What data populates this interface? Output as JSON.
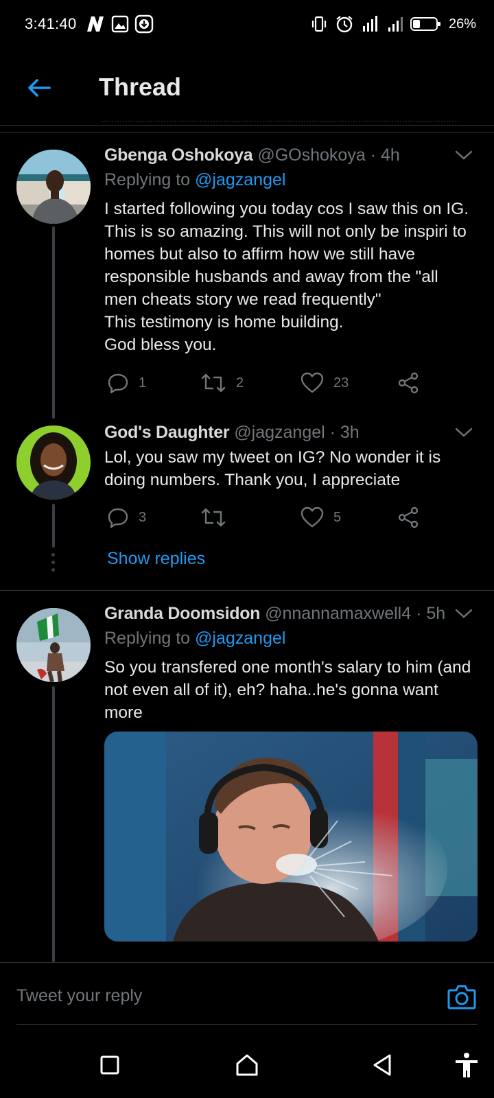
{
  "status_bar": {
    "time": "3:41:40",
    "battery": "26%",
    "left_icons": [
      "n-app-icon",
      "gallery-icon",
      "download-icon"
    ],
    "right_icons": [
      "vibrate-icon",
      "alarm-icon",
      "signal-icon",
      "signal-icon",
      "battery-icon"
    ]
  },
  "header": {
    "title": "Thread"
  },
  "tweets": [
    {
      "name": "Gbenga Oshokoya",
      "meta": "@GOshokoya · 4h",
      "replying_prefix": "Replying to ",
      "replying_to": "@jagzangel",
      "text_lines": [
        "I started following you today cos I saw this on IG.",
        "This is so amazing. This will not only be inspiri to",
        "homes but also to affirm how we still have",
        "responsible husbands and away from the \"all",
        "men cheats story we read frequently\"",
        "This testimony is home building.",
        "God bless you."
      ],
      "replies": "1",
      "retweets": "2",
      "likes": "23"
    },
    {
      "name": "God's Daughter",
      "meta": "@jagzangel · 3h",
      "text_lines": [
        "Lol, you saw my tweet on IG? No wonder it is",
        "doing numbers. Thank you, I appreciate"
      ],
      "replies": "3",
      "retweets": "",
      "likes": "5",
      "show_replies": "Show replies"
    },
    {
      "name": "Granda Doomsidon",
      "meta": "@nnannamaxwell4 · 5h",
      "replying_prefix": "Replying to ",
      "replying_to": "@jagzangel",
      "text_lines": [
        "So you transfered one month's salary to him (and",
        "not even all of it), eh? haha..he's gonna want",
        "more"
      ]
    }
  ],
  "composer": {
    "placeholder": "Tweet your reply"
  },
  "nav_bar": {
    "buttons": [
      "recents-button",
      "home-button",
      "back-button",
      "accessibility-button"
    ]
  },
  "colors": {
    "background": "#000000",
    "accent": "#1d9bf0",
    "muted": "#71767b",
    "text": "#e7e9ea"
  }
}
